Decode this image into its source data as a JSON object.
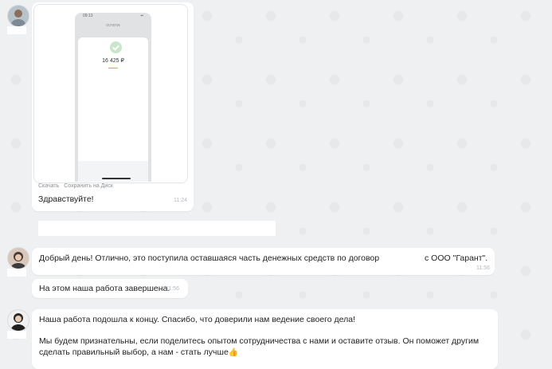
{
  "messages": {
    "first": {
      "links": {
        "download": "Скачать",
        "save_to_disk": "Сохранить на Диск"
      },
      "phone": {
        "status_time": "09:13",
        "title": "остаток",
        "amount": "16 425 ₽"
      },
      "text": "Здравствуйте!",
      "time": "11:24"
    },
    "second": {
      "text_before": "Добрый день! Отлично, это поступила оставшаяся часть денежных средств по договору №",
      "text_after": "с ООО \"Гарант\".",
      "time": "11:56"
    },
    "third": {
      "text": "На этом наша работа завершена.",
      "time": "11:56"
    },
    "fourth": {
      "line1": "Наша работа подошла к концу. Спасибо, что доверили нам ведение своего дела!",
      "line2": "Мы будем признательны, если поделитесь опытом сотрудничества с нами и оставите отзыв. Он поможет другим сделать правильный выбор, а нам - стать лучше",
      "emoji": "👍"
    }
  },
  "colors": {
    "background": "#eef0f2",
    "bubble": "#ffffff",
    "time": "#b3b8be",
    "redacted": "#ffffff"
  }
}
